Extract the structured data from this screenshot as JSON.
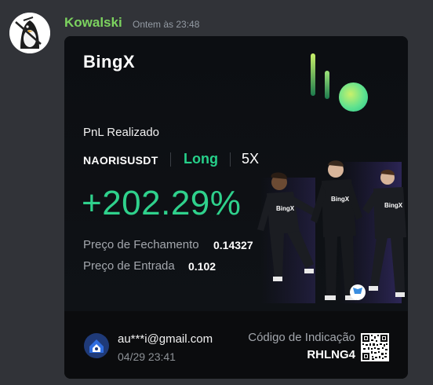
{
  "message": {
    "username": "Kowalski",
    "timestamp": "Ontem às 23:48",
    "username_color": "#7cd35f"
  },
  "card": {
    "logo": "BingX",
    "title": "PnL Realizado",
    "symbol": "NAORISUSDT",
    "side": "Long",
    "leverage": "5X",
    "pnl_percent": "+202.29%",
    "close_price_label": "Preço de Fechamento",
    "close_price": "0.14327",
    "entry_price_label": "Preço de Entrada",
    "entry_price": "0.102",
    "jersey_text": "BingX",
    "accent_color": "#2fd18c"
  },
  "footer": {
    "email": "au***i@gmail.com",
    "date": "04/29 23:41",
    "referral_label": "Código de Indicação",
    "referral_code": "RHLNG4"
  }
}
